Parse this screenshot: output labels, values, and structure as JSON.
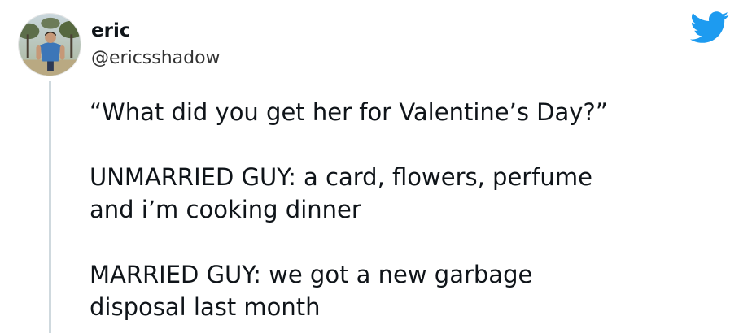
{
  "tweet": {
    "author": {
      "display_name": "eric",
      "handle": "@ericsshadow",
      "avatar_icon": "profile-photo"
    },
    "brand": {
      "icon": "twitter-bird-icon",
      "color": "#1d9bf0"
    },
    "text": "“What did you get her for Valentine’s Day?”\n\nUNMARRIED GUY: a card, flowers, perfume\nand i’m cooking dinner\n\nMARRIED GUY: we got a new garbage\ndisposal last month"
  }
}
